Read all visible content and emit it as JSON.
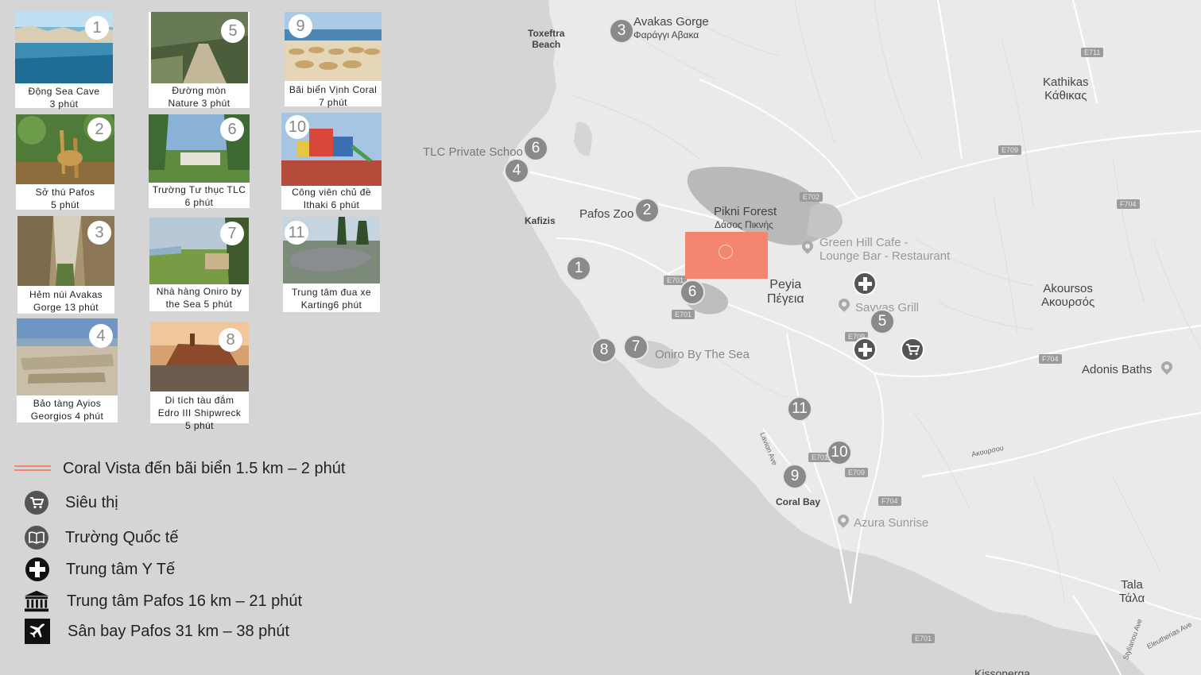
{
  "photo_cards": [
    {
      "num": "1",
      "caption": "Động Sea Cave\n3 phút"
    },
    {
      "num": "2",
      "caption": "Sở thú Pafos\n5 phút"
    },
    {
      "num": "3",
      "caption": "Hẻm núi Avakas\nGorge 13 phút"
    },
    {
      "num": "4",
      "caption": "Bảo tàng Ayios\nGeorgios 4 phút"
    },
    {
      "num": "5",
      "caption": "Đường mòn\nNature 3 phút"
    },
    {
      "num": "6",
      "caption": "Trường Tư thục TLC\n6 phút"
    },
    {
      "num": "7",
      "caption": "Nhà hàng Oniro by\nthe Sea 5 phút"
    },
    {
      "num": "8",
      "caption": "Di tích tàu đắm\nEdro III Shipwreck\n5 phút"
    },
    {
      "num": "9",
      "caption": "Bãi biển Vịnh Coral\n7 phút"
    },
    {
      "num": "10",
      "caption": "Công viên chủ đề\nIthaki 6 phút"
    },
    {
      "num": "11",
      "caption": "Trung tâm đua xe\nKarting6 phút"
    }
  ],
  "legend": {
    "route": "Coral Vista đến bãi biển 1.5 km – 2 phút",
    "supermarket": "Siêu thị",
    "school": "Trường Quốc tế",
    "medical": "Trung tâm Y Tế",
    "city_center": "Trung tâm Pafos 16 km – 21 phút",
    "airport": "Sân bay Pafos 31 km – 38 phút"
  },
  "map": {
    "labels": {
      "toxeftra": "Toxeftra\nBeach",
      "avakas_en": "Avakas Gorge",
      "avakas_gr": "Φαράγγι Αβακα",
      "kathikas": "Kathikas\nΚάθικας",
      "tlc": "TLC Private Schoo",
      "kafizis": "Kafizis",
      "pafos_zoo": "Pafos Zoo",
      "pikni_en": "Pikni Forest",
      "pikni_gr": "Δάσος Πικνής",
      "green_hill": "Green Hill Cafe -\nLounge Bar - Restaurant",
      "peyia": "Peyia\nΠέγεια",
      "savvas": "Savvas Grill",
      "akoursos": "Akoursos\nΑκουρσός",
      "oniro": "Oniro By The Sea",
      "adonis": "Adonis Baths",
      "lavion": "Lavion Ave",
      "akoursou": "Ακουρσου",
      "coral_bay": "Coral Bay",
      "azura": "Azura Sunrise",
      "tala": "Tala\nΤάλα",
      "eleutherias": "Eleutherias Ave",
      "stylianou": "Stylianou Ave",
      "kissonerga": "Kissonerga"
    },
    "road_badges": [
      "E711",
      "E709",
      "E702",
      "F704",
      "E701",
      "E701",
      "E709",
      "E701",
      "E709",
      "F704",
      "F704",
      "E701"
    ],
    "markers": [
      {
        "num": "3"
      },
      {
        "num": "6"
      },
      {
        "num": "4"
      },
      {
        "num": "2"
      },
      {
        "num": "1"
      },
      {
        "num": "6"
      },
      {
        "num": "7"
      },
      {
        "num": "8"
      },
      {
        "num": "5"
      },
      {
        "num": "11"
      },
      {
        "num": "10"
      },
      {
        "num": "9"
      }
    ]
  },
  "colors": {
    "accent": "#f4856e",
    "marker": "#8a8a8a",
    "map_bg": "#eaeaea",
    "sea": "#d5d5d5"
  }
}
